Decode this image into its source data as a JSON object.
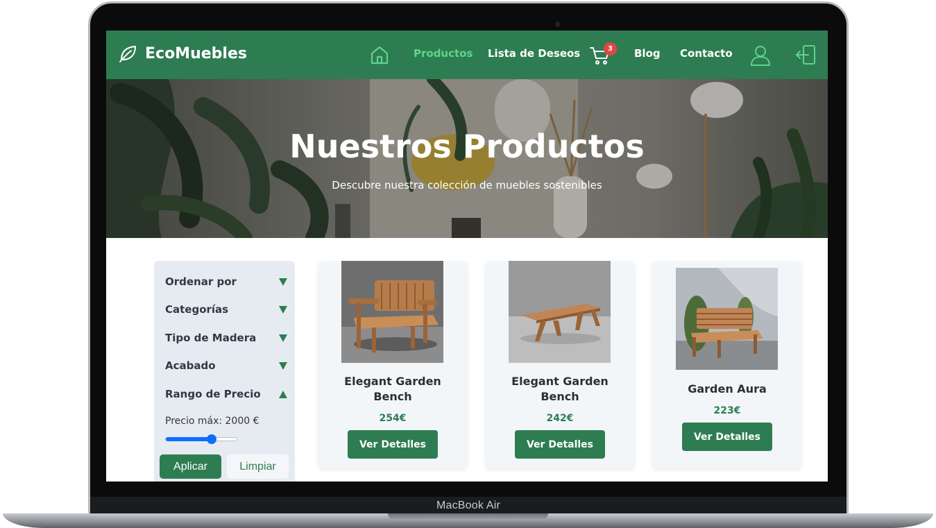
{
  "device": {
    "label": "MacBook Air"
  },
  "navbar": {
    "brand": "EcoMuebles",
    "items": [
      {
        "label": "Productos",
        "active": true
      },
      {
        "label": "Lista de Deseos",
        "active": false
      },
      {
        "label": "Blog",
        "active": false
      },
      {
        "label": "Contacto",
        "active": false
      }
    ],
    "cart_count": "3",
    "icons": [
      "leaf-icon",
      "home-icon",
      "cart-icon",
      "user-icon",
      "logout-icon"
    ]
  },
  "hero": {
    "title": "Nuestros Productos",
    "subtitle": "Descubre nuestra colección de muebles sostenibles"
  },
  "filters": {
    "sections": [
      {
        "label": "Ordenar por",
        "expanded": false
      },
      {
        "label": "Categorías",
        "expanded": false
      },
      {
        "label": "Tipo de Madera",
        "expanded": false
      },
      {
        "label": "Acabado",
        "expanded": false
      },
      {
        "label": "Rango de Precio",
        "expanded": true
      }
    ],
    "price_label": "Precio máx: 2000 €",
    "price_slider_fraction": 0.65,
    "apply_label": "Aplicar",
    "clear_label": "Limpiar"
  },
  "products": [
    {
      "name": "Elegant Garden Bench",
      "price": "254€",
      "button": "Ver Detalles"
    },
    {
      "name": "Elegant Garden Bench",
      "price": "242€",
      "button": "Ver Detalles"
    },
    {
      "name": "Garden Aura",
      "price": "223€",
      "button": "Ver Detalles"
    }
  ],
  "colors": {
    "primary": "#2e7d52",
    "active_nav": "#5fd48a",
    "badge": "#e64545",
    "slider": "#0d6efd"
  }
}
